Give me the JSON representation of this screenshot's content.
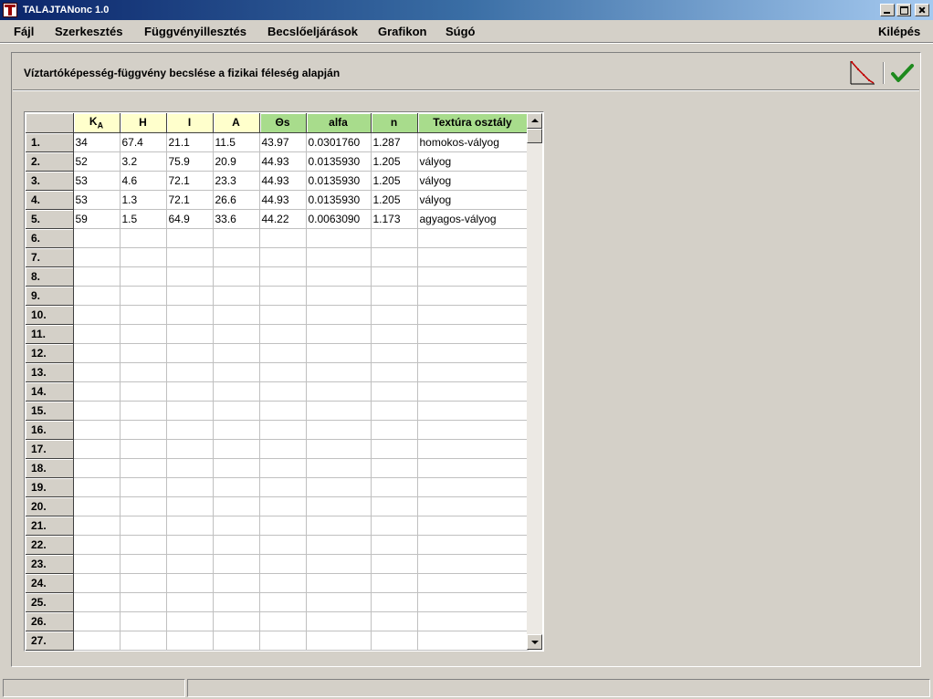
{
  "window": {
    "title": "TALAJTANonc 1.0",
    "icon": "app-icon"
  },
  "menu": {
    "file": "Fájl",
    "edit": "Szerkesztés",
    "fit": "Függvényillesztés",
    "estimate": "Becslőeljárások",
    "chart": "Grafikon",
    "help": "Súgó",
    "exit": "Kilépés"
  },
  "panel": {
    "title": "Víztartóképesség-függvény becslése a fizikai féleség alapján"
  },
  "toolbar": {
    "chart_icon": "retention-curve-icon",
    "ok_icon": "checkmark-icon"
  },
  "colors": {
    "input_header": "#ffffcc",
    "output_header": "#a8dc8c"
  },
  "grid": {
    "columns": [
      {
        "key": "ka",
        "label": "KA",
        "main": "K",
        "sub": "A",
        "group": "input"
      },
      {
        "key": "h",
        "label": "H",
        "group": "input"
      },
      {
        "key": "i",
        "label": "I",
        "group": "input"
      },
      {
        "key": "a",
        "label": "A",
        "group": "input"
      },
      {
        "key": "ts",
        "label": "Θs",
        "group": "output"
      },
      {
        "key": "alfa",
        "label": "alfa",
        "group": "output"
      },
      {
        "key": "n",
        "label": "n",
        "group": "output"
      },
      {
        "key": "tex",
        "label": "Textúra osztály",
        "group": "output"
      }
    ],
    "rows": [
      {
        "num": "1.",
        "ka": "34",
        "h": "67.4",
        "i": "21.1",
        "a": "11.5",
        "ts": "43.97",
        "alfa": "0.0301760",
        "n": "1.287",
        "tex": "homokos-vályog"
      },
      {
        "num": "2.",
        "ka": "52",
        "h": "3.2",
        "i": "75.9",
        "a": "20.9",
        "ts": "44.93",
        "alfa": "0.0135930",
        "n": "1.205",
        "tex": "vályog"
      },
      {
        "num": "3.",
        "ka": "53",
        "h": "4.6",
        "i": "72.1",
        "a": "23.3",
        "ts": "44.93",
        "alfa": "0.0135930",
        "n": "1.205",
        "tex": "vályog"
      },
      {
        "num": "4.",
        "ka": "53",
        "h": "1.3",
        "i": "72.1",
        "a": "26.6",
        "ts": "44.93",
        "alfa": "0.0135930",
        "n": "1.205",
        "tex": "vályog"
      },
      {
        "num": "5.",
        "ka": "59",
        "h": "1.5",
        "i": "64.9",
        "a": "33.6",
        "ts": "44.22",
        "alfa": "0.0063090",
        "n": "1.173",
        "tex": "agyagos-vályog"
      },
      {
        "num": "6."
      },
      {
        "num": "7."
      },
      {
        "num": "8."
      },
      {
        "num": "9."
      },
      {
        "num": "10."
      },
      {
        "num": "11."
      },
      {
        "num": "12."
      },
      {
        "num": "13."
      },
      {
        "num": "14."
      },
      {
        "num": "15."
      },
      {
        "num": "16."
      },
      {
        "num": "17."
      },
      {
        "num": "18."
      },
      {
        "num": "19."
      },
      {
        "num": "20."
      },
      {
        "num": "21."
      },
      {
        "num": "22."
      },
      {
        "num": "23."
      },
      {
        "num": "24."
      },
      {
        "num": "25."
      },
      {
        "num": "26."
      },
      {
        "num": "27."
      }
    ]
  },
  "status": {
    "pane1": "",
    "pane2": ""
  }
}
